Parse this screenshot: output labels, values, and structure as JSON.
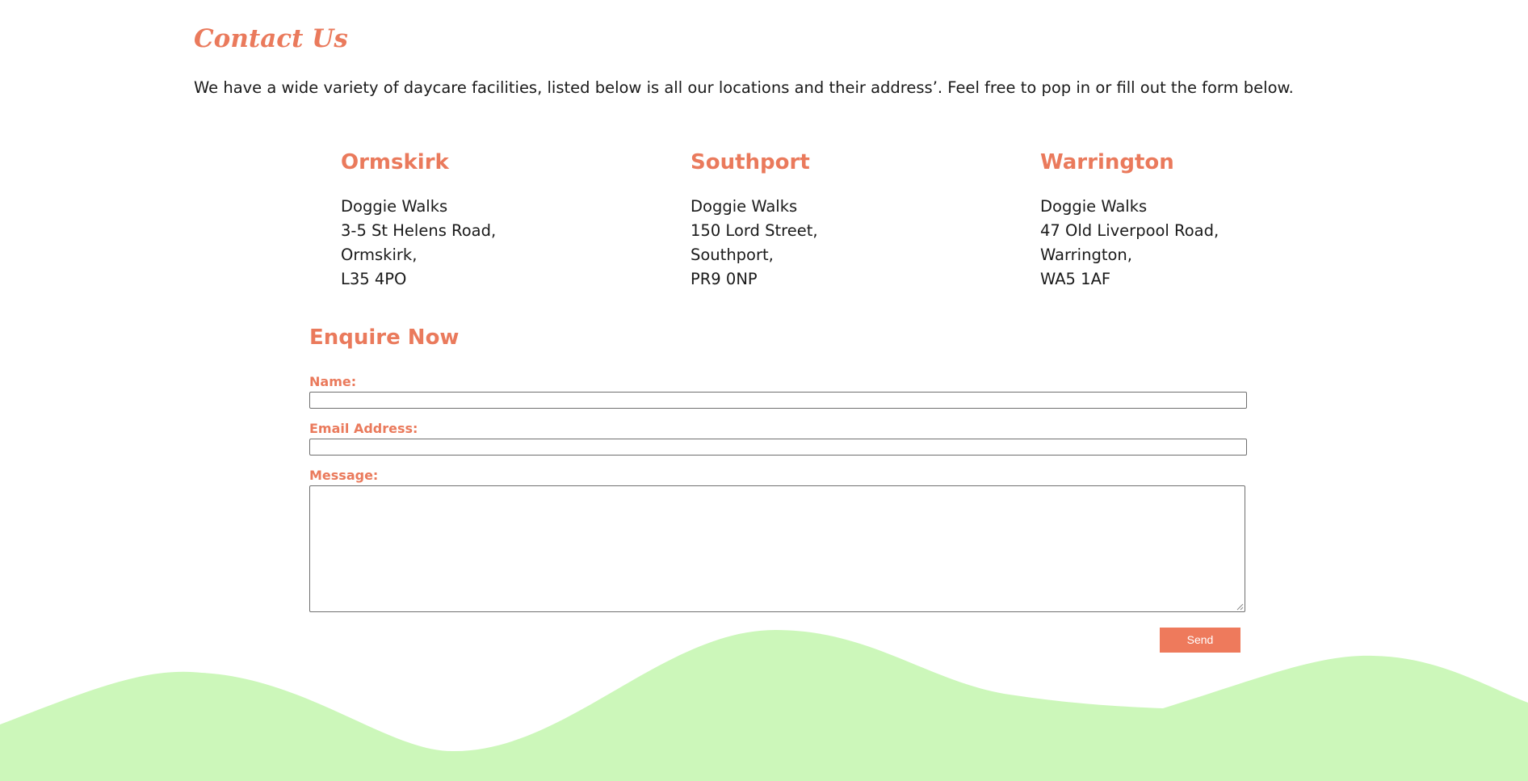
{
  "page": {
    "title": "Contact Us",
    "intro": "We have a wide variety of daycare facilities, listed below is all our locations and their address’. Feel free to pop in or fill out the form below."
  },
  "locations": [
    {
      "name": "Ormskirk",
      "address": [
        "Doggie Walks",
        "3-5 St Helens Road,",
        "Ormskirk,",
        "L35 4PO"
      ]
    },
    {
      "name": "Southport",
      "address": [
        "Doggie Walks",
        "150 Lord Street,",
        "Southport,",
        "PR9 0NP"
      ]
    },
    {
      "name": "Warrington",
      "address": [
        "Doggie Walks",
        "47 Old Liverpool Road,",
        "Warrington,",
        "WA5 1AF"
      ]
    }
  ],
  "form": {
    "title": "Enquire Now",
    "name_label": "Name:",
    "name_value": "",
    "email_label": "Email Address:",
    "email_value": "",
    "message_label": "Message:",
    "message_value": "",
    "send_label": "Send"
  },
  "colors": {
    "accent": "#ea7a5c",
    "button": "#ee7a5c",
    "wave": "#ccf7ba",
    "text": "#1a1a1a"
  }
}
